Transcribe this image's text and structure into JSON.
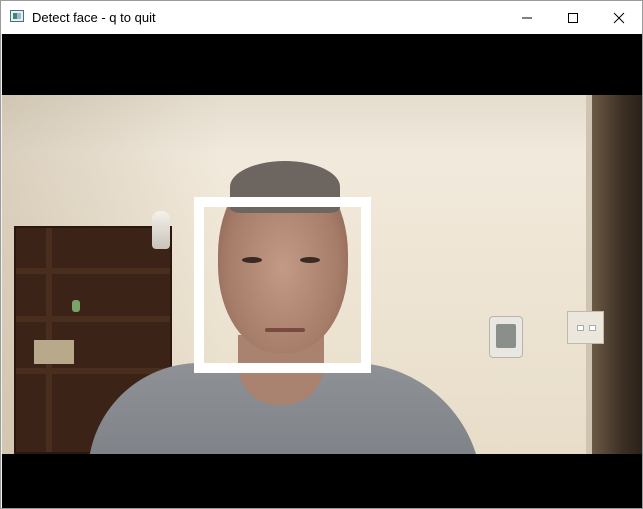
{
  "window": {
    "title": "Detect face - q to quit",
    "app_icon": "opencv-window-icon",
    "controls": {
      "minimize_icon": "minimize-icon",
      "maximize_icon": "maximize-icon",
      "close_icon": "close-icon"
    }
  },
  "video": {
    "letterbox_color": "#000000",
    "detection_box_color": "#ffffff",
    "detections_shown": 1
  }
}
